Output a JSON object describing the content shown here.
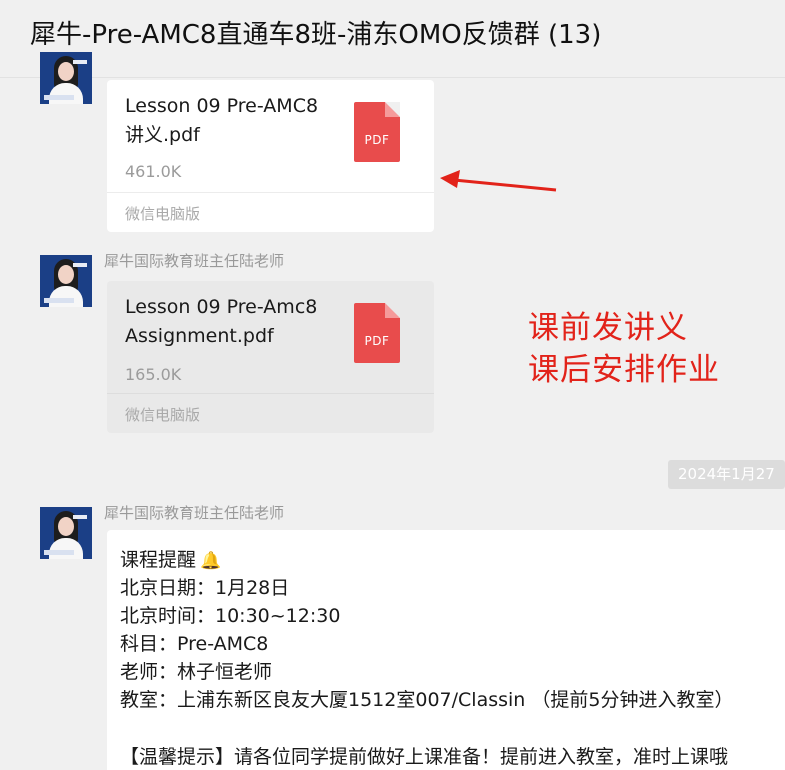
{
  "window": {
    "title": "犀牛-Pre-AMC8直通车8班-浦东OMO反馈群 (13)"
  },
  "messages": [
    {
      "sender": "",
      "file": {
        "name": "Lesson 09 Pre-AMC8 讲义.pdf",
        "size": "461.0K",
        "source": "微信电脑版",
        "icon_label": "PDF"
      }
    },
    {
      "sender": "犀牛国际教育班主任陆老师",
      "file": {
        "name": "Lesson 09 Pre-Amc8 Assignment.pdf",
        "size": "165.0K",
        "source": "微信电脑版",
        "icon_label": "PDF"
      }
    }
  ],
  "annotation": {
    "line1": "课前发讲义",
    "line2": "课后安排作业",
    "color": "#e2231a"
  },
  "timestamp": "2024年1月27",
  "reminder": {
    "sender": "犀牛国际教育班主任陆老师",
    "title": "课程提醒",
    "title_icon": "bell-icon",
    "date_line": "北京日期：1月28日",
    "time_line": "北京时间：10:30~12:30",
    "subject_line": "科目：Pre-AMC8",
    "teacher_line": "老师：林子恒老师",
    "room_line": "教室：上浦东新区良友大厦1512室007/Classin （提前5分钟进入教室）",
    "tip_line": "【温馨提示】请各位同学提前做好上课准备！提前进入教室，准时上课哦"
  },
  "colors": {
    "background": "#f0f0f0",
    "bubble": "#ffffff",
    "pdf_icon": "#e84c4c",
    "arrow": "#e2231a"
  }
}
